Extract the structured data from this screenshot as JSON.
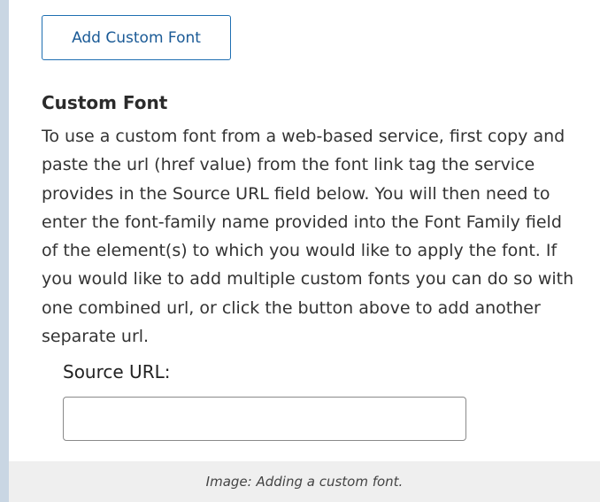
{
  "toolbar": {
    "add_custom_font_label": "Add Custom Font"
  },
  "custom_font": {
    "title": "Custom Font",
    "description": "To use a custom font from a web-based service, first copy and paste the url (href value) from the font link tag the service provides in the Source URL field below. You will then need to enter the font-family name provided into the Font Family field of the element(s) to which you would like to apply the font. If you would like to add multiple custom fonts you can do so with one combined url, or click the button above to add another separate url.",
    "source_url_label": "Source URL:",
    "source_url_value": ""
  },
  "caption": "Image: Adding a custom font.",
  "colors": {
    "accent": "#1f6fb2",
    "caption_background": "#efefef",
    "outer_frame": "#c9d6e3"
  }
}
